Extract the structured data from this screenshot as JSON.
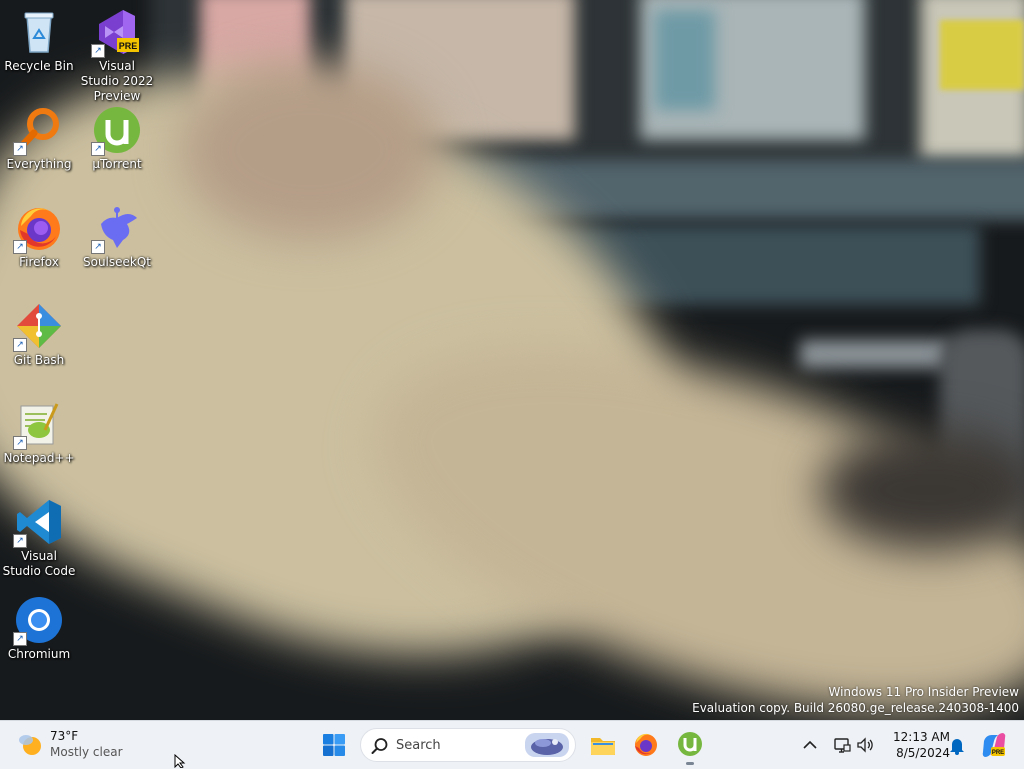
{
  "desktop": {
    "icons": [
      {
        "label": "Recycle Bin",
        "icon": "recycle-bin-icon",
        "shortcut": false
      },
      {
        "label": "Visual Studio 2022 Preview",
        "icon": "visual-studio-icon",
        "badge": "PRE",
        "shortcut": true
      },
      {
        "label": "Everything",
        "icon": "everything-search-icon",
        "shortcut": true
      },
      {
        "label": "µTorrent",
        "icon": "utorrent-icon",
        "shortcut": true
      },
      {
        "label": "Firefox",
        "icon": "firefox-icon",
        "shortcut": true
      },
      {
        "label": "SoulseekQt",
        "icon": "soulseek-icon",
        "shortcut": true
      },
      {
        "label": "Git Bash",
        "icon": "git-bash-icon",
        "shortcut": true
      },
      {
        "label": "Notepad++",
        "icon": "notepadpp-icon",
        "shortcut": true
      },
      {
        "label": "Visual Studio Code",
        "icon": "vscode-icon",
        "shortcut": true
      },
      {
        "label": "Chromium",
        "icon": "chromium-icon",
        "shortcut": true
      }
    ]
  },
  "watermark": {
    "line1": "Windows 11 Pro Insider Preview",
    "line2": "Evaluation copy. Build 26080.ge_release.240308-1400"
  },
  "taskbar": {
    "weather": {
      "temp": "73°F",
      "condition": "Mostly clear",
      "icon": "weather-sun-icon"
    },
    "start_icon": "windows-start-icon",
    "search": {
      "placeholder": "Search",
      "icon": "search-icon",
      "highlight_icon": "search-highlight-icon"
    },
    "pinned": [
      {
        "name": "File Explorer",
        "icon": "file-explorer-icon",
        "running": false
      },
      {
        "name": "Firefox",
        "icon": "firefox-icon",
        "running": false
      },
      {
        "name": "µTorrent",
        "icon": "utorrent-icon",
        "running": true
      }
    ],
    "tray": {
      "chevron_icon": "chevron-up-icon",
      "network_icon": "network-icon",
      "volume_icon": "volume-icon",
      "notification_icon": "bell-icon",
      "copilot_icon": "copilot-icon"
    },
    "clock": {
      "time": "12:13 AM",
      "date": "8/5/2024"
    }
  },
  "colors": {
    "taskbar_bg": "#eef1f6",
    "start_blue": "#1a7fe0",
    "accent_blue": "#0067c0"
  }
}
